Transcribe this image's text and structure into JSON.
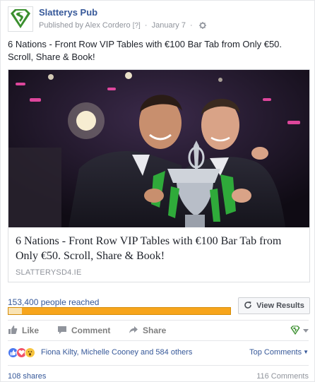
{
  "header": {
    "page_name": "Slatterys Pub",
    "published_by": "Published by Alex Cordero",
    "help_mark": "[?]",
    "separator": "·",
    "date": "January 7",
    "logo_icon": "superman-shield-logo",
    "settings_icon": "gear-icon"
  },
  "post": {
    "text": "6 Nations - Front Row VIP Tables with €100 Bar Tab from Only €50. Scroll, Share & Book!"
  },
  "link_preview": {
    "image_alt": "Two rugby players holding a trophy",
    "title": "6 Nations - Front Row VIP Tables with €100 Bar Tab from Only €50. Scroll, Share & Book!",
    "domain": "SLATTERYSD4.IE"
  },
  "reach": {
    "text": "153,400 people reached",
    "organic_fraction": 0.06,
    "view_results_label": "View Results",
    "colors": {
      "paid": "#f7a51c",
      "organic": "#f9e3b4"
    }
  },
  "actions": {
    "like": "Like",
    "comment": "Comment",
    "share": "Share",
    "like_icon": "thumbs-up-icon",
    "comment_icon": "comment-icon",
    "share_icon": "share-arrow-icon"
  },
  "reactions": {
    "icons": [
      "like-reaction-icon",
      "love-reaction-icon",
      "wow-reaction-icon"
    ],
    "names": "Fiona Kilty, Michelle Cooney and 584 others",
    "top_comments": "Top Comments"
  },
  "footer": {
    "shares": "108 shares",
    "comments": "116 Comments"
  },
  "colors": {
    "link": "#365899",
    "muted": "#90949c",
    "logo_green": "#3a8f2e"
  }
}
